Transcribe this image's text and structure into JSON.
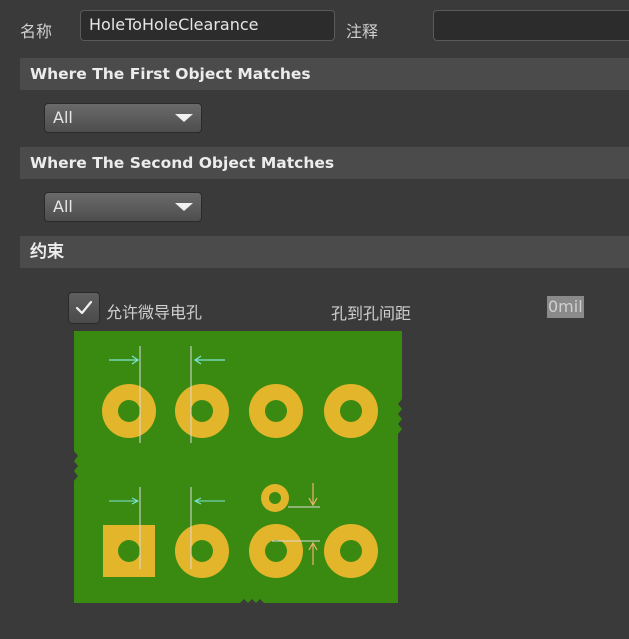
{
  "header": {
    "name_label": "名称",
    "name_value": "HoleToHoleClearance",
    "comment_label": "注释",
    "comment_value": ""
  },
  "first_match": {
    "title": "Where The First Object Matches",
    "selected": "All"
  },
  "second_match": {
    "title": "Where The Second Object Matches",
    "selected": "All"
  },
  "constraints": {
    "title": "约束",
    "allow_stacked_micro_vias": {
      "label": "允许微导电孔",
      "checked": true
    },
    "hole_to_hole_label": "孔到孔间距",
    "hole_to_hole_value": "0mil"
  },
  "colors": {
    "board": "#3a8a12",
    "pad": "#e3b52a",
    "arrow_cyan": "#7fe3d6",
    "arrow_orange": "#f0b070"
  }
}
